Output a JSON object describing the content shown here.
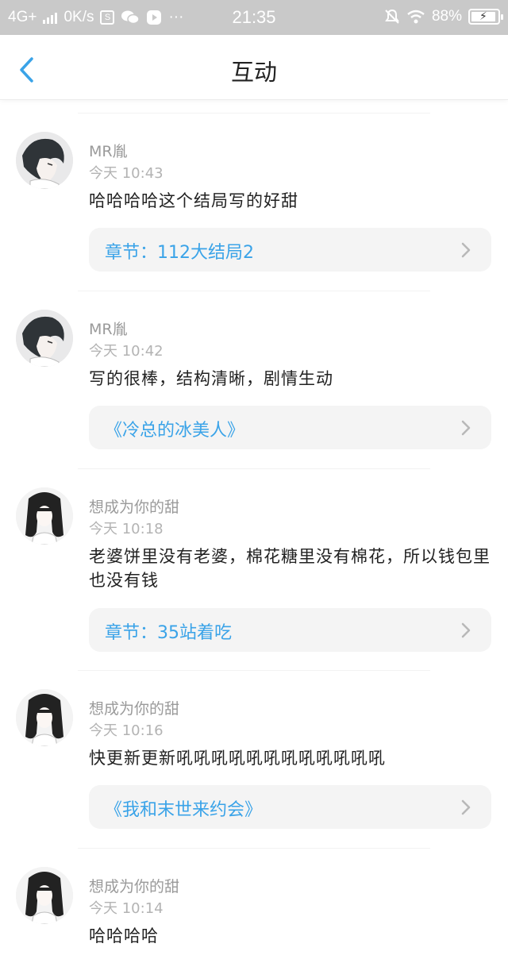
{
  "status_bar": {
    "network": "4G+",
    "speed": "0K/s",
    "more": "···",
    "time": "21:35",
    "battery": "88%"
  },
  "header": {
    "title": "互动"
  },
  "comments": [
    {
      "user": "MR胤",
      "time": "今天 10:43",
      "text": "哈哈哈哈这个结局写的好甜",
      "link": "章节：112大结局2",
      "avatar": "avatar-boy"
    },
    {
      "user": "MR胤",
      "time": "今天 10:42",
      "text": "写的很棒，结构清晰，剧情生动",
      "link": "《冷总的冰美人》",
      "avatar": "avatar-boy"
    },
    {
      "user": "想成为你的甜",
      "time": "今天 10:18",
      "text": "老婆饼里没有老婆，棉花糖里没有棉花，所以钱包里也没有钱",
      "link": "章节：35站着吃",
      "avatar": "avatar-girl"
    },
    {
      "user": "想成为你的甜",
      "time": "今天 10:16",
      "text": "快更新更新吼吼吼吼吼吼吼吼吼吼吼吼",
      "link": "《我和末世来约会》",
      "avatar": "avatar-girl"
    },
    {
      "user": "想成为你的甜",
      "time": "今天 10:14",
      "text": "哈哈哈哈",
      "avatar": "avatar-girl"
    }
  ],
  "colors": {
    "accent": "#3aa3e8",
    "status_bar_bg": "#c9c9c9",
    "chip_bg": "#f4f4f4"
  }
}
